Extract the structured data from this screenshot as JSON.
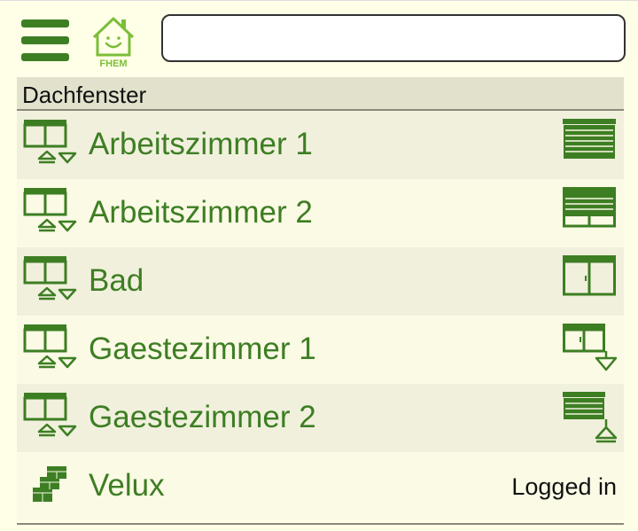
{
  "header": {
    "logo_text": "FHEM",
    "search_value": "",
    "search_placeholder": ""
  },
  "room": {
    "title": "Dachfenster",
    "devices": [
      {
        "name": "Arbeitszimmer 1",
        "state_icon": "shade-closed-icon"
      },
      {
        "name": "Arbeitszimmer 2",
        "state_icon": "shade-mostly-closed-icon"
      },
      {
        "name": "Bad",
        "state_icon": "window-open-icon"
      },
      {
        "name": "Gaestezimmer 1",
        "state_icon": "shade-down-icon"
      },
      {
        "name": "Gaestezimmer 2",
        "state_icon": "shade-up-icon"
      },
      {
        "name": "Velux",
        "state": "Logged in"
      }
    ]
  },
  "colors": {
    "accent": "#3D7E23",
    "background": "#FFFFE7",
    "header": "#E2E1CC"
  }
}
